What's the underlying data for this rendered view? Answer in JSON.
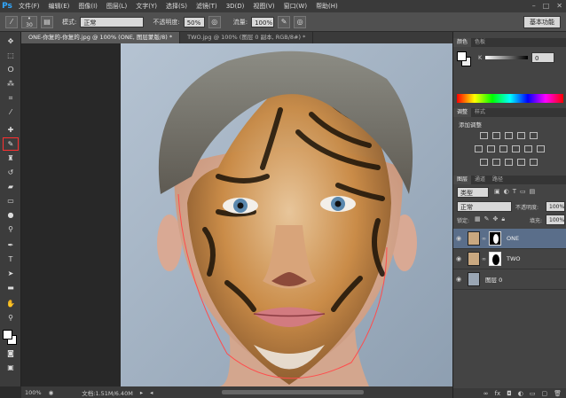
{
  "app": {
    "logo": "Ps"
  },
  "menu": [
    "文件(F)",
    "编辑(E)",
    "图像(I)",
    "图层(L)",
    "文字(Y)",
    "选择(S)",
    "滤镜(T)",
    "3D(D)",
    "视图(V)",
    "窗口(W)",
    "帮助(H)"
  ],
  "options": {
    "brush_size": "30",
    "mode_label": "模式:",
    "mode_value": "正常",
    "opacity_label": "不透明度:",
    "opacity_value": "50%",
    "flow_label": "流量:",
    "flow_value": "100%",
    "workspace": "基本功能"
  },
  "tabs": [
    {
      "label": "ONE-你复的-你复的.jpg @ 100% (ONE, 图层蒙版/8) *",
      "active": true
    },
    {
      "label": "TWO.jpg @ 100% (图层 0 副本, RGB/8#) *",
      "active": false
    }
  ],
  "status": {
    "zoom": "100%",
    "doc_info": "文档:1.51M/6.40M"
  },
  "color_panel": {
    "tabs": [
      "颜色",
      "色板"
    ],
    "k_label": "K",
    "k_value": "0"
  },
  "adjust_panel": {
    "tabs": [
      "调整",
      "样式"
    ],
    "title": "添加调整"
  },
  "layers_panel": {
    "tabs": [
      "图层",
      "通道",
      "路径"
    ],
    "filter_value": "类型",
    "blend_mode": "正常",
    "opacity_label": "不透明度:",
    "opacity_value": "100%",
    "lock_label": "锁定:",
    "fill_label": "填充:",
    "fill_value": "100%",
    "layers": [
      {
        "name": "ONE"
      },
      {
        "name": "TWO"
      },
      {
        "name": "图层 0"
      }
    ]
  },
  "colors": {
    "accent_blue": "#31a8ff",
    "selected_layer": "#5a6e8a",
    "active_tool_outline": "#ff3030"
  }
}
